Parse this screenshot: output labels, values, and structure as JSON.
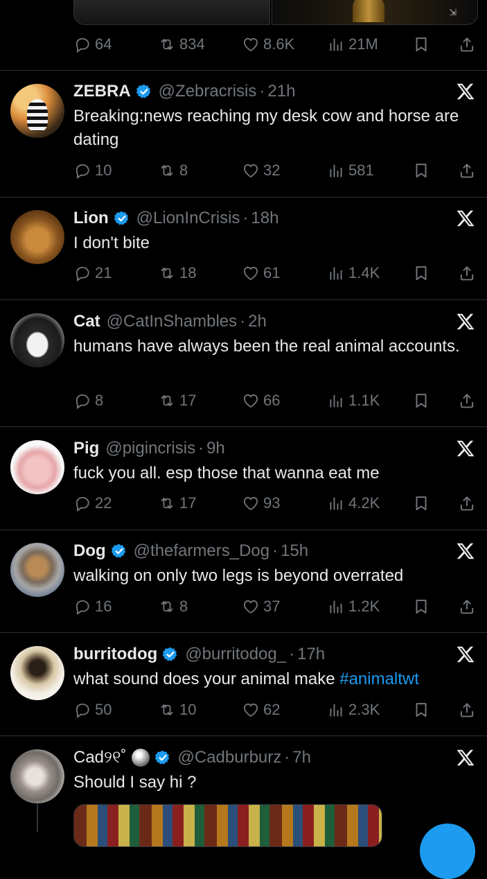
{
  "top_post": {
    "stats": {
      "replies": "64",
      "reposts": "834",
      "likes": "8.6K",
      "views": "21M"
    }
  },
  "tweets": [
    {
      "name": "ZEBRA",
      "verified": true,
      "handle": "@Zebracrisis",
      "dot": "·",
      "time": "21h",
      "text": "Breaking:news reaching my desk cow and horse are dating",
      "stats": {
        "replies": "10",
        "reposts": "8",
        "likes": "32",
        "views": "581"
      }
    },
    {
      "name": "Lion",
      "verified": true,
      "handle": "@LionInCrisis",
      "dot": "·",
      "time": "18h",
      "text": "I don't bite",
      "stats": {
        "replies": "21",
        "reposts": "18",
        "likes": "61",
        "views": "1.4K"
      }
    },
    {
      "name": "Cat",
      "verified": false,
      "handle": "@CatInShambles",
      "dot": "·",
      "time": "2h",
      "text": "humans have always been the real animal accounts.",
      "stats": {
        "replies": "8",
        "reposts": "17",
        "likes": "66",
        "views": "1.1K"
      }
    },
    {
      "name": "Pig",
      "verified": false,
      "handle": "@pigincrisis",
      "dot": "·",
      "time": "9h",
      "text": "fuck you all. esp those that wanna eat me",
      "stats": {
        "replies": "22",
        "reposts": "17",
        "likes": "93",
        "views": "4.2K"
      }
    },
    {
      "name": "Dog",
      "verified": true,
      "handle": "@thefarmers_Dog",
      "dot": "·",
      "time": "15h",
      "text": "walking on only two legs is beyond overrated",
      "stats": {
        "replies": "16",
        "reposts": "8",
        "likes": "37",
        "views": "1.2K"
      }
    },
    {
      "name": "burritodog",
      "verified": true,
      "handle": "@burritodog_",
      "dot": "·",
      "time": "17h",
      "text": "what sound does your animal make ",
      "hashtag": "#animaltwt",
      "stats": {
        "replies": "50",
        "reposts": "10",
        "likes": "62",
        "views": "2.3K"
      }
    },
    {
      "name": "Cad୨୧˚",
      "verified": true,
      "handle": "@Cadburburz",
      "dot": "·",
      "time": "7h",
      "text": "Should I say hi ?"
    }
  ],
  "icons": {
    "reply": "reply-icon",
    "repost": "repost-icon",
    "like": "heart-icon",
    "views": "views-icon",
    "bookmark": "bookmark-icon",
    "share": "share-icon",
    "platform": "x-logo-icon",
    "verified": "verified-badge-icon"
  },
  "colors": {
    "background": "#000000",
    "text": "#e7e9ea",
    "muted": "#71767b",
    "accent": "#1d9bf0",
    "divider": "#2f3336"
  }
}
